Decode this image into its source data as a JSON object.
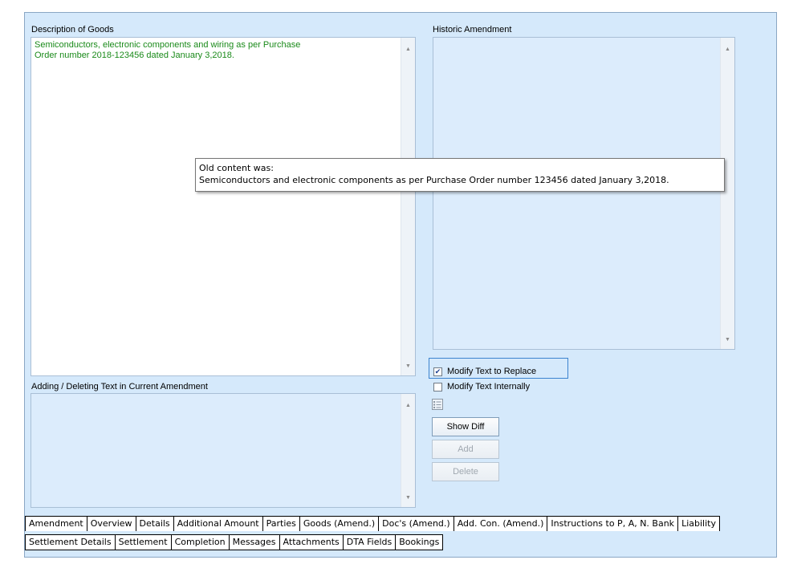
{
  "description": {
    "label": "Description of Goods",
    "line1": "Semiconductors, electronic components and wiring as per Purchase",
    "line2": "Order number 2018-123456 dated January 3,2018."
  },
  "historic": {
    "label": "Historic Amendment"
  },
  "tooltip": {
    "line1": "Old content was:",
    "line2": "Semiconductors and electronic components as per Purchase Order number 123456 dated January 3,2018."
  },
  "adding": {
    "label": "Adding / Deleting Text in Current Amendment"
  },
  "options": {
    "modify_replace": "Modify Text to Replace",
    "modify_replace_checked": true,
    "modify_internal": "Modify Text Internally",
    "modify_internal_checked": false
  },
  "buttons": {
    "show_diff": "Show Diff",
    "add": "Add",
    "delete": "Delete"
  },
  "icons": {
    "check": "checkmark-icon",
    "list": "list-icon",
    "up": "scroll-up-arrow-icon",
    "down": "scroll-down-arrow-icon"
  },
  "tabs_row1": [
    "Amendment",
    "Overview",
    "Details",
    "Additional Amount",
    "Parties",
    "Goods (Amend.)",
    "Doc's (Amend.)",
    "Add. Con. (Amend.)",
    "Instructions to P, A, N. Bank",
    "Liability"
  ],
  "tabs_row2": [
    "Settlement Details",
    "Settlement",
    "Completion",
    "Messages",
    "Attachments",
    "DTA Fields",
    "Bookings"
  ]
}
